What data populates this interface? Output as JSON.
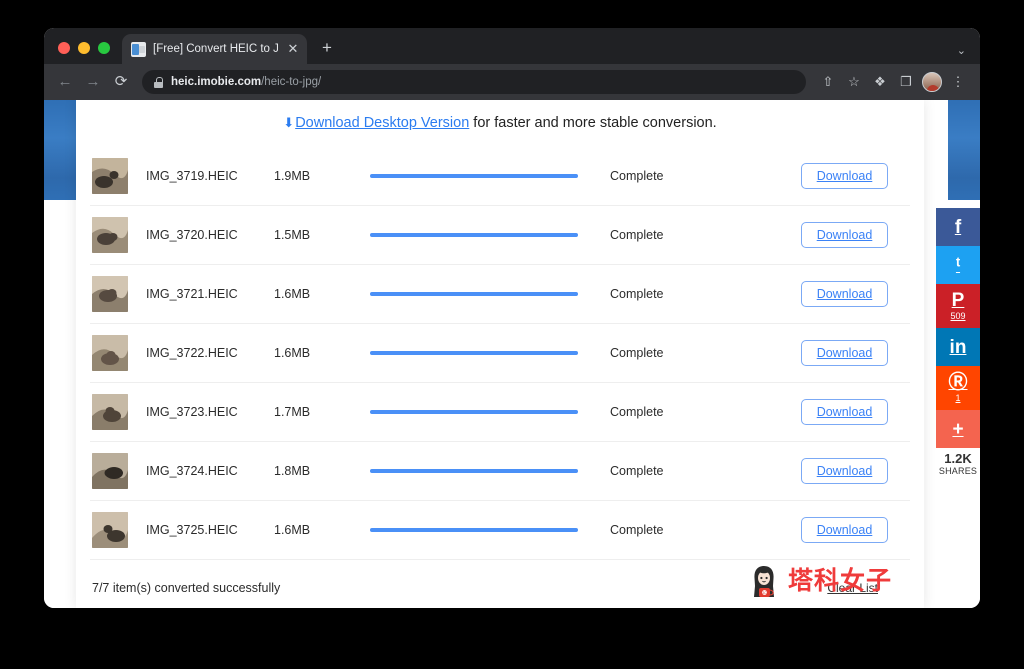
{
  "browser": {
    "tab": {
      "title": "[Free] Convert HEIC to JPG/PN",
      "favicon": "document-image-icon",
      "close_label": "✕"
    },
    "new_tab_label": "+",
    "tabstrip_chevron": "⌄",
    "nav": {
      "back_label": "←",
      "forward_label": "→",
      "reload_label": "⟳"
    },
    "omnibox": {
      "lock_icon": "lock-icon",
      "host": "heic.imobie.com",
      "path": "/heic-to-jpg/"
    },
    "toolbar_icons": {
      "share_label": "⇧",
      "bookmark_label": "☆",
      "extensions_label": "❖",
      "cast_label": "❐",
      "menu_label": "⋮",
      "avatar_label": "avatar-icon"
    }
  },
  "promo": {
    "arrow": "⬇",
    "link_text": "Download Desktop Version",
    "rest_text": "for faster and more stable conversion."
  },
  "file_table": {
    "rows": [
      {
        "name": "IMG_3719.HEIC",
        "size": "1.9MB",
        "status": "Complete",
        "progress": 100,
        "download_label": "Download"
      },
      {
        "name": "IMG_3720.HEIC",
        "size": "1.5MB",
        "status": "Complete",
        "progress": 100,
        "download_label": "Download"
      },
      {
        "name": "IMG_3721.HEIC",
        "size": "1.6MB",
        "status": "Complete",
        "progress": 100,
        "download_label": "Download"
      },
      {
        "name": "IMG_3722.HEIC",
        "size": "1.6MB",
        "status": "Complete",
        "progress": 100,
        "download_label": "Download"
      },
      {
        "name": "IMG_3723.HEIC",
        "size": "1.7MB",
        "status": "Complete",
        "progress": 100,
        "download_label": "Download"
      },
      {
        "name": "IMG_3724.HEIC",
        "size": "1.8MB",
        "status": "Complete",
        "progress": 100,
        "download_label": "Download"
      },
      {
        "name": "IMG_3725.HEIC",
        "size": "1.6MB",
        "status": "Complete",
        "progress": 100,
        "download_label": "Download"
      }
    ]
  },
  "footer": {
    "summary": "7/7 item(s) converted successfully",
    "clear_list_label": "Clear List"
  },
  "watermark": {
    "text": "塔科女子"
  },
  "share_rail": {
    "buttons": [
      {
        "network": "facebook",
        "glyph": "f",
        "count": ""
      },
      {
        "network": "twitter",
        "glyph": "ᵗ",
        "count": ""
      },
      {
        "network": "pinterest",
        "glyph": "P",
        "count": "509"
      },
      {
        "network": "linkedin",
        "glyph": "in",
        "count": ""
      },
      {
        "network": "reddit",
        "glyph": "Ⓡ",
        "count": "1"
      },
      {
        "network": "more",
        "glyph": "+",
        "count": ""
      }
    ],
    "total_count": "1.2K",
    "total_label": "SHARES"
  },
  "colors": {
    "accent_blue": "#3b82f6",
    "progress_blue": "#4a90f7",
    "promo_blue": "#2b7cf0",
    "page_side_blue": "#2f6fb5",
    "watermark_red": "#ef3b3b"
  }
}
